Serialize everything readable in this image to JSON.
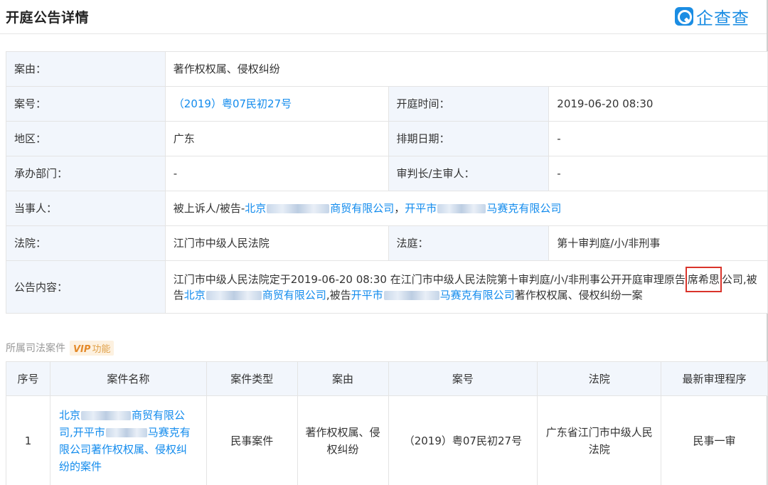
{
  "header": {
    "title": "开庭公告详情",
    "logo_text": "企查查"
  },
  "detail": {
    "case_reason_label": "案由：",
    "case_reason_value": "著作权权属、侵权纠纷",
    "case_no_label": "案号：",
    "case_no_value": "（2019）粤07民初27号",
    "hearing_time_label": "开庭时间：",
    "hearing_time_value": "2019-06-20 08:30",
    "region_label": "地区：",
    "region_value": "广东",
    "schedule_date_label": "排期日期：",
    "schedule_date_value": "-",
    "department_label": "承办部门：",
    "department_value": "-",
    "judge_label": "审判长/主审人：",
    "judge_value": "-",
    "parties_label": "当事人：",
    "parties_prefix": "被上诉人/被告-",
    "party1_start": "北京",
    "party1_end": "商贸有限公司",
    "separator": "，",
    "party2_start": "开平市",
    "party2_end": "马赛克有限公司",
    "court_label": "法院：",
    "court_value": "江门市中级人民法院",
    "tribunal_label": "法庭：",
    "tribunal_value": "第十审判庭/小/非刑事",
    "notice_label": "公告内容：",
    "notice_part1": "江门市中级人民法院定于2019-06-20 08:30 在江门市中级人民法院第十审判庭/小/非刑事公开开庭审理原告",
    "notice_highlight": "席希思",
    "notice_part2": "公司,被告",
    "notice_party1_start": "北京",
    "notice_party1_end": "商贸有限公司",
    "notice_part3": ",被告",
    "notice_party2_start": "开平市",
    "notice_party2_end": "马赛克有限公司",
    "notice_part4": "著作权权属、侵权纠纷一案"
  },
  "section": {
    "title": "所属司法案件",
    "vip_mark": "VIP",
    "vip_text": "功能"
  },
  "cases": {
    "headers": [
      "序号",
      "案件名称",
      "案件类型",
      "案由",
      "案号",
      "法院",
      "最新审理程序"
    ],
    "rows": [
      {
        "index": "1",
        "name_start": "北京",
        "name_mid": "商贸有限公司,开平市",
        "name_end": "马赛克有限公司著作权权属、侵权纠纷的案件",
        "type": "民事案件",
        "reason": "著作权权属、侵权纠纷",
        "case_no": "（2019）粤07民初27号",
        "court": "广东省江门市中级人民法院",
        "procedure": "民事一审"
      }
    ]
  }
}
